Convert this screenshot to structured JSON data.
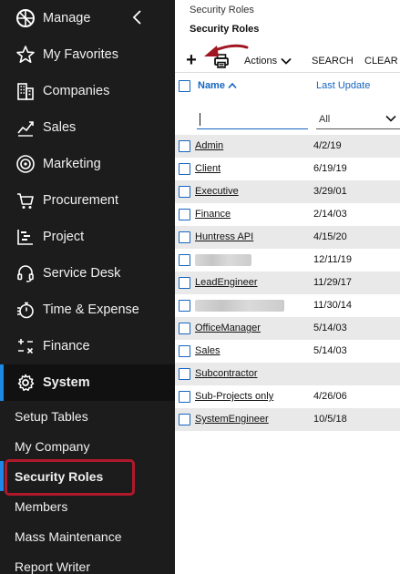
{
  "sidebar": {
    "nav": [
      {
        "label": "Manage",
        "icon": "manage-wheel-icon"
      },
      {
        "label": "My Favorites",
        "icon": "star-icon"
      },
      {
        "label": "Companies",
        "icon": "building-icon"
      },
      {
        "label": "Sales",
        "icon": "chart-trend-icon"
      },
      {
        "label": "Marketing",
        "icon": "target-icon"
      },
      {
        "label": "Procurement",
        "icon": "cart-icon"
      },
      {
        "label": "Project",
        "icon": "gantt-icon"
      },
      {
        "label": "Service Desk",
        "icon": "headset-icon"
      },
      {
        "label": "Time & Expense",
        "icon": "stopwatch-icon"
      },
      {
        "label": "Finance",
        "icon": "calculator-icon"
      },
      {
        "label": "System",
        "icon": "gear-icon"
      }
    ],
    "active_nav": "System",
    "sub_items": [
      {
        "label": "Setup Tables"
      },
      {
        "label": "My Company"
      },
      {
        "label": "Security Roles"
      },
      {
        "label": "Members"
      },
      {
        "label": "Mass Maintenance"
      },
      {
        "label": "Report Writer"
      }
    ],
    "active_sub": "Security Roles",
    "accent_color": "#1e88e5",
    "highlight_color": "#b0192b"
  },
  "main": {
    "breadcrumb": "Security Roles",
    "title": "Security Roles",
    "toolbar": {
      "add": "+",
      "actions_label": "Actions",
      "search_label": "SEARCH",
      "clear_label": "CLEAR"
    },
    "columns": {
      "name": "Name",
      "last_update": "Last Update"
    },
    "filters": {
      "name_value": "",
      "date_value": "All"
    },
    "rows": [
      {
        "name": "Admin",
        "date": "4/2/19"
      },
      {
        "name": "Client",
        "date": "6/19/19"
      },
      {
        "name": "Executive",
        "date": "3/29/01"
      },
      {
        "name": "Finance",
        "date": "2/14/03"
      },
      {
        "name": "Huntress API",
        "date": "4/15/20"
      },
      {
        "name": "",
        "date": "12/11/19",
        "redacted": true
      },
      {
        "name": "LeadEngineer",
        "date": "11/29/17"
      },
      {
        "name": "",
        "date": "11/30/14",
        "redacted": true
      },
      {
        "name": "OfficeManager",
        "date": "5/14/03"
      },
      {
        "name": "Sales",
        "date": "5/14/03"
      },
      {
        "name": "Subcontractor",
        "date": ""
      },
      {
        "name": "Sub-Projects only",
        "date": "4/26/06"
      },
      {
        "name": "SystemEngineer",
        "date": "10/5/18"
      }
    ]
  }
}
